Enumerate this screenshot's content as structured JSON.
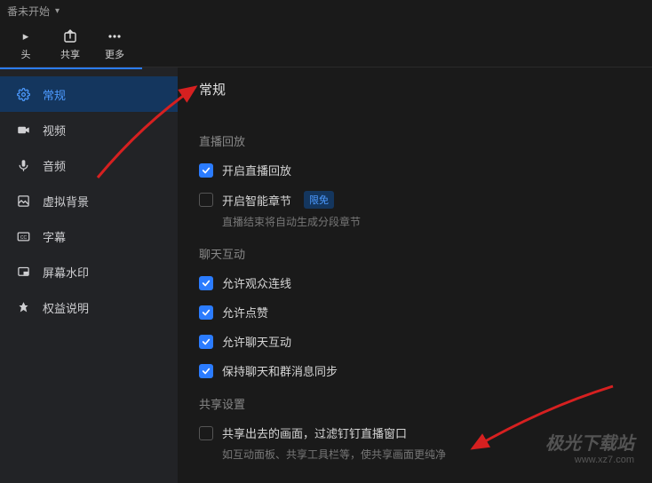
{
  "topbar": {
    "status": "番未开始"
  },
  "toolbar": {
    "items": [
      {
        "label": "头",
        "icon": "camera-icon"
      },
      {
        "label": "共享",
        "icon": "share-icon"
      },
      {
        "label": "更多",
        "icon": "more-icon"
      }
    ]
  },
  "sidebar": {
    "items": [
      {
        "label": "常规",
        "icon": "gear-icon",
        "active": true
      },
      {
        "label": "视频",
        "icon": "video-icon"
      },
      {
        "label": "音频",
        "icon": "mic-icon"
      },
      {
        "label": "虚拟背景",
        "icon": "background-icon"
      },
      {
        "label": "字幕",
        "icon": "cc-icon"
      },
      {
        "label": "屏幕水印",
        "icon": "watermark-icon"
      },
      {
        "label": "权益说明",
        "icon": "badge-icon"
      }
    ]
  },
  "content": {
    "title": "常规",
    "sections": [
      {
        "title": "直播回放",
        "options": [
          {
            "label": "开启直播回放",
            "checked": true
          },
          {
            "label": "开启智能章节",
            "checked": false,
            "badge": "限免",
            "hint": "直播结束将自动生成分段章节"
          }
        ]
      },
      {
        "title": "聊天互动",
        "options": [
          {
            "label": "允许观众连线",
            "checked": true
          },
          {
            "label": "允许点赞",
            "checked": true
          },
          {
            "label": "允许聊天互动",
            "checked": true
          },
          {
            "label": "保持聊天和群消息同步",
            "checked": true
          }
        ]
      },
      {
        "title": "共享设置",
        "options": [
          {
            "label": "共享出去的画面，过滤钉钉直播窗口",
            "checked": false,
            "hint": "如互动面板、共享工具栏等，使共享画面更纯净"
          }
        ]
      }
    ]
  },
  "watermark": {
    "line1": "极光下载站",
    "line2": "www.xz7.com"
  }
}
